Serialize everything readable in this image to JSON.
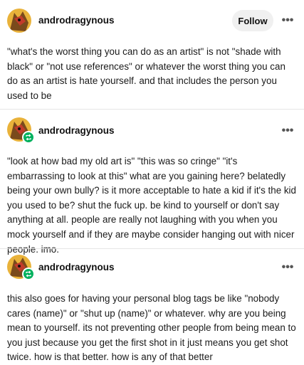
{
  "post1": {
    "username": "androdragynous",
    "follow_label": "Follow",
    "menu_icon": "more-icon",
    "text": "\"what's the worst thing you can do as an artist\" is not \"shade with black\" or \"not use references\" or whatever the worst thing you can do as an artist is hate yourself. and that includes the person you used to be"
  },
  "post2": {
    "username": "androdragynous",
    "menu_icon": "more-icon",
    "text": "\"look at how bad my old art is\" \"this was so cringe\" \"it's embarrassing to look at this\" what are you gaining here? belatedly being your own bully? is it more acceptable to hate a kid if it's the kid you used to be? shut the fuck up. be kind to yourself or don't say anything at all. people are really not laughing with you when you mock yourself and if they are maybe consider hanging out with nicer people. imo."
  },
  "post3": {
    "username": "androdragynous",
    "menu_icon": "more-icon",
    "text": "this also goes for having your personal blog tags be like \"nobody cares (name)\" or \"shut up (name)\" or whatever. why are you being mean to yourself. its not preventing other people from being mean to you just because you get the first shot in it just means you get shot twice. how is that better. how is any of that better"
  },
  "colors": {
    "reblog_badge": "#00b15e",
    "follow_bg": "#f0f0f0",
    "avatar_bg": "#e9b23a"
  }
}
